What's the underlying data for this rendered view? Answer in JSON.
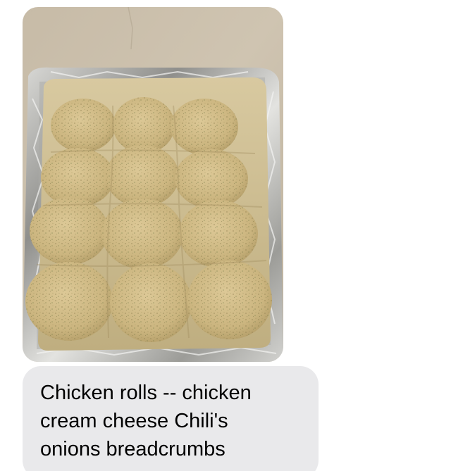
{
  "message_thread": {
    "photo_message": {
      "subject": "tray-of-breaded-chicken-rolls-in-foil-pan"
    },
    "text_message": {
      "text": "Chicken rolls -- chicken\ncream cheese Chili's\nonions breadcrumbs"
    }
  },
  "colors": {
    "received_bubble": "#e9e9eb",
    "message_text": "#000000",
    "background": "#ffffff",
    "countertop": "#c8bca8",
    "foil": "#b6b6b2",
    "roll": "#cdb785"
  }
}
